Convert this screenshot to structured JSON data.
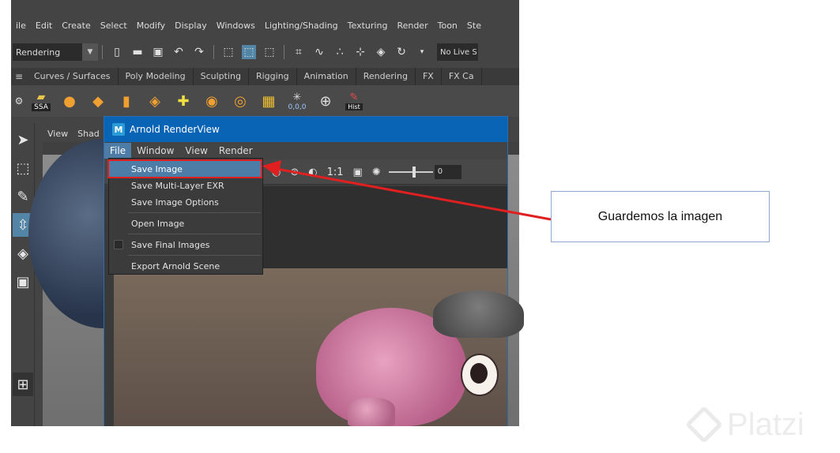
{
  "menubar": {
    "items": [
      "ile",
      "Edit",
      "Create",
      "Select",
      "Modify",
      "Display",
      "Windows",
      "Lighting/Shading",
      "Texturing",
      "Render",
      "Toon",
      "Ste"
    ]
  },
  "toolbar": {
    "mode_select": "Rendering",
    "live_select": "No Live S"
  },
  "shelf_tabs": [
    "Curves / Surfaces",
    "Poly Modeling",
    "Sculpting",
    "Rigging",
    "Animation",
    "Rendering",
    "FX",
    "FX Ca"
  ],
  "shelf": {
    "icons": [
      {
        "name": "ssa-folder-icon",
        "label": "SSA"
      },
      {
        "name": "sphere-icon"
      },
      {
        "name": "cube-icon"
      },
      {
        "name": "cylinder-icon"
      },
      {
        "name": "plane-icon"
      },
      {
        "name": "light-icon"
      },
      {
        "name": "render-icon"
      },
      {
        "name": "ipr-icon"
      },
      {
        "name": "grid-icon"
      },
      {
        "name": "sparkle-icon",
        "label": "0,0,0"
      },
      {
        "name": "snapshot-icon"
      },
      {
        "name": "hist-icon",
        "label": "Hist"
      }
    ]
  },
  "viewport": {
    "menu": [
      "View",
      "Shad"
    ]
  },
  "renderview": {
    "title": "Arnold RenderView",
    "menu": [
      "File",
      "Window",
      "View",
      "Render"
    ],
    "ratio_label": "1:1",
    "exposure_value": "0"
  },
  "file_menu": {
    "items": [
      "Save Image",
      "Save Multi-Layer EXR",
      "Save Image Options",
      "Open Image",
      "Save Final Images",
      "Export Arnold Scene"
    ]
  },
  "callout": {
    "text": "Guardemos la imagen"
  },
  "watermark": {
    "text": "Platzi"
  },
  "colors": {
    "highlight_red": "#e02020",
    "maya_blue": "#0a64b6",
    "menu_highlight": "#4d7da6",
    "callout_border": "#8fa9cf"
  }
}
